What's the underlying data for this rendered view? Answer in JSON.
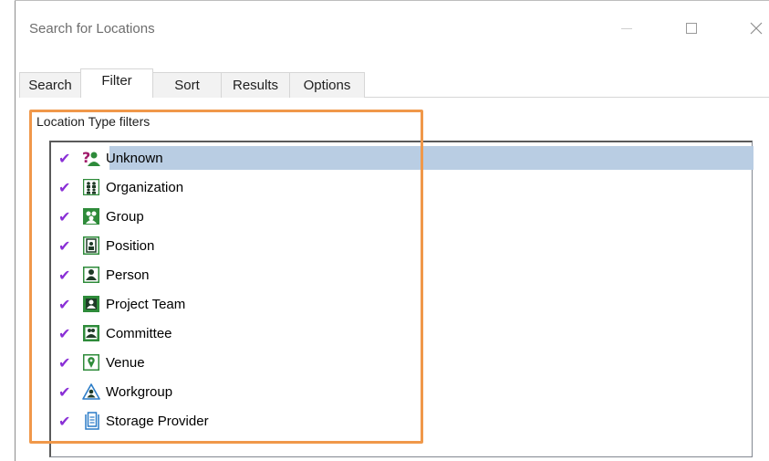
{
  "window": {
    "title": "Search for Locations"
  },
  "tabs": [
    {
      "label": "Search",
      "active": false
    },
    {
      "label": "Filter",
      "active": true
    },
    {
      "label": "Sort",
      "active": false
    },
    {
      "label": "Results",
      "active": false
    },
    {
      "label": "Options",
      "active": false
    }
  ],
  "filter_panel": {
    "group_label": "Location Type filters",
    "items": [
      {
        "label": "Unknown",
        "checked": true,
        "selected": true,
        "icon": "unknown-icon"
      },
      {
        "label": "Organization",
        "checked": true,
        "icon": "organization-icon"
      },
      {
        "label": "Group",
        "checked": true,
        "icon": "group-icon"
      },
      {
        "label": "Position",
        "checked": true,
        "icon": "position-icon"
      },
      {
        "label": "Person",
        "checked": true,
        "icon": "person-icon"
      },
      {
        "label": "Project Team",
        "checked": true,
        "icon": "project-team-icon"
      },
      {
        "label": "Committee",
        "checked": true,
        "icon": "committee-icon"
      },
      {
        "label": "Venue",
        "checked": true,
        "icon": "venue-icon"
      },
      {
        "label": "Workgroup",
        "checked": true,
        "icon": "workgroup-icon"
      },
      {
        "label": "Storage Provider",
        "checked": true,
        "icon": "storage-provider-icon"
      }
    ],
    "check_glyph": "✔"
  },
  "colors": {
    "check": "#8a2fd6",
    "selection": "#b9cde3",
    "highlight_border": "#f0984a",
    "icon_green": "#2e8b3a"
  }
}
